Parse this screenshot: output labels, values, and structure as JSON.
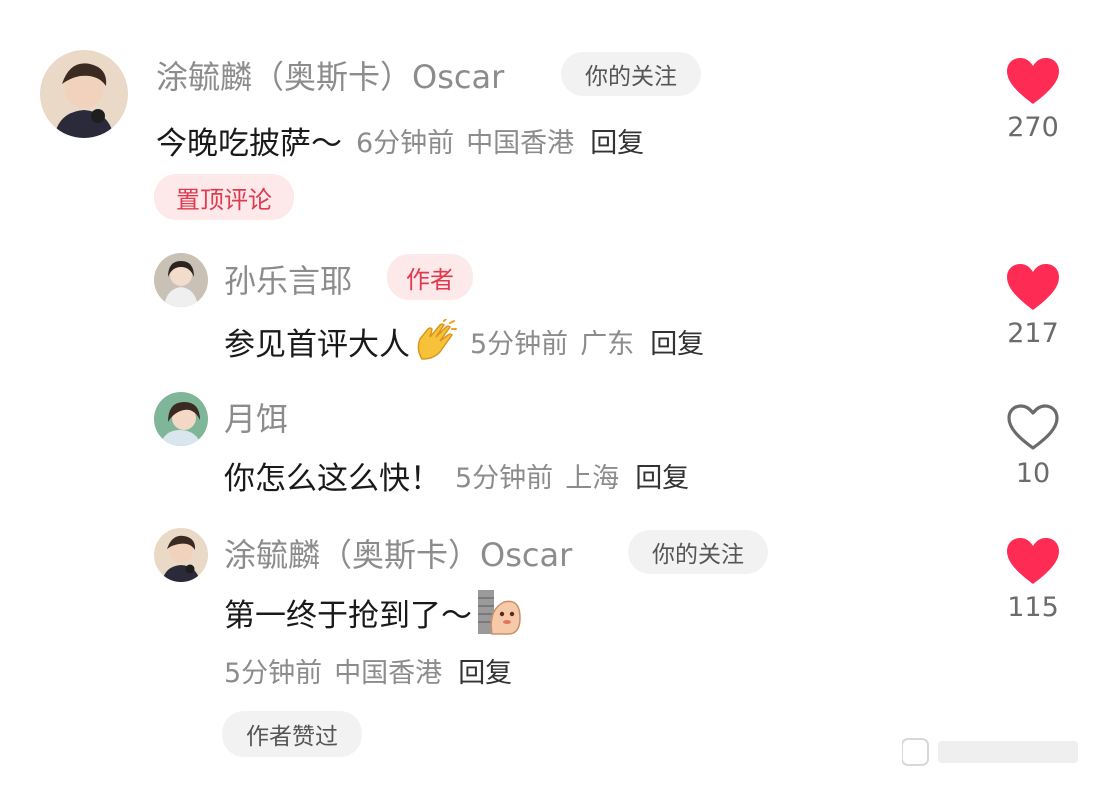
{
  "comment_main": {
    "user": "涂毓麟（奥斯卡）Oscar",
    "follow_badge": "你的关注",
    "text": "今晚吃披萨～",
    "time": "6分钟前",
    "location": "中国香港",
    "reply_label": "回复",
    "pinned_badge": "置顶评论",
    "likes": "270",
    "liked": true
  },
  "replies": [
    {
      "user": "孙乐言耶",
      "author_badge": "作者",
      "text": "参见首评大人",
      "emoji": "clapping-hands-emoji",
      "time": "5分钟前",
      "location": "广东",
      "reply_label": "回复",
      "likes": "217",
      "liked": true
    },
    {
      "user": "月饵",
      "text": "你怎么这么快！",
      "time": "5分钟前",
      "location": "上海",
      "reply_label": "回复",
      "likes": "10",
      "liked": false
    },
    {
      "user": "涂毓麟（奥斯卡）Oscar",
      "follow_badge": "你的关注",
      "text": "第一终于抢到了～",
      "emoji": "peeking-sticker-emoji",
      "time": "5分钟前",
      "location": "中国香港",
      "reply_label": "回复",
      "author_liked_badge": "作者赞过",
      "likes": "115",
      "liked": true
    }
  ],
  "colors": {
    "like_red": "#fe2c55",
    "badge_red_text": "#e03a4e",
    "badge_red_bg": "#fde8ea",
    "meta_gray": "#8c8c8c"
  }
}
